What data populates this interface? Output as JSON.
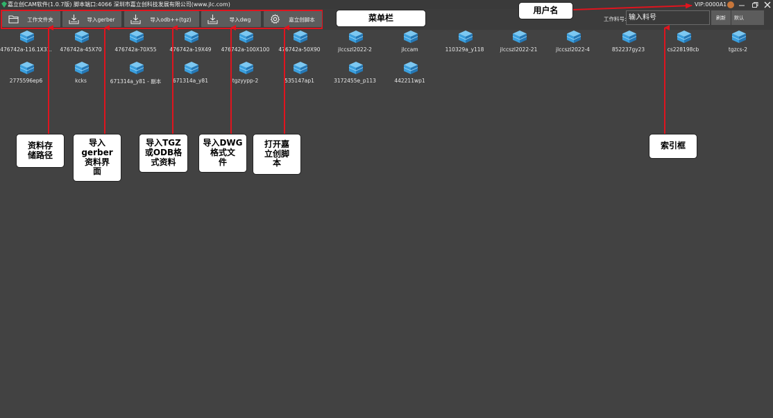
{
  "titlebar": {
    "title": "嘉立创CAM软件(1.0.7版) 脚本端口:4066 深圳市嘉立创科技发展有限公司(www.jlc.com)",
    "vip": "VIP:0000A1"
  },
  "toolbar": {
    "buttons": [
      {
        "label": "工作文件夹",
        "icon": "folder-icon"
      },
      {
        "label": "导入gerber",
        "icon": "import-icon"
      },
      {
        "label": "导入odb++(tgz)",
        "icon": "import-icon"
      },
      {
        "label": "导入dwg",
        "icon": "import-icon"
      },
      {
        "label": "嘉立创脚本",
        "icon": "gear-icon"
      }
    ],
    "job_label": "工作料号:",
    "job_placeholder": "输入料号",
    "refresh_label": "刷新",
    "default_label": "默认"
  },
  "jobs": [
    "476742a-116.1X31.",
    "476742a-45X70",
    "476742a-70X55",
    "476742a-19X49",
    "476742a-100X100",
    "476742a-50X90",
    "jlccszl2022-2",
    "jlccam",
    "110329a_y118",
    "jlccszl2022-21",
    "jlccszl2022-4",
    "852237gy23",
    "cs228198cb",
    "tgzcs-2",
    "2775596ep6",
    "kcks",
    "671314a_y81 - 副本",
    "671314a_y81",
    "tgzyypp-2",
    "535147ap1",
    "3172455e_p113",
    "442211wp1"
  ],
  "annotations": {
    "menu_bar": "菜单栏",
    "username": "用户名",
    "storage_path": "资料存\n储路径",
    "gerber": "导入\ngerber\n资料界\n面",
    "tgz": "导入TGZ\n或ODB格\n式资料",
    "dwg": "导入DWG\n格式文\n件",
    "script": "打开嘉\n立创脚\n本",
    "search_box": "索引框"
  },
  "colors": {
    "background": "#424242",
    "annotation_red": "#e0141e",
    "cube_blue": "#3a9fde"
  }
}
